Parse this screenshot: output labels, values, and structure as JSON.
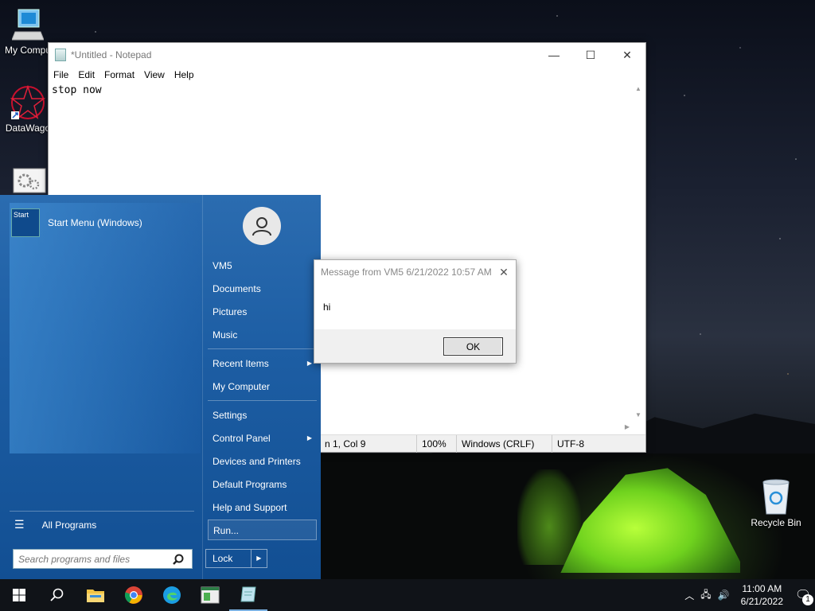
{
  "desktop": {
    "icons": [
      {
        "label": "My Compu",
        "icon": "computer-icon"
      },
      {
        "label": "DataWago",
        "icon": "datawagon-icon"
      },
      {
        "label": "",
        "icon": "settings-window-icon"
      },
      {
        "label": "Recycle Bin",
        "icon": "recycle-bin-icon"
      }
    ]
  },
  "notepad": {
    "title": "*Untitled - Notepad",
    "menu": [
      "File",
      "Edit",
      "Format",
      "View",
      "Help"
    ],
    "content": "stop now",
    "status": {
      "position": "n 1, Col 9",
      "zoom": "100%",
      "line_ending": "Windows (CRLF)",
      "encoding": "UTF-8"
    },
    "buttons": {
      "minimize": "—",
      "maximize": "☐",
      "close": "✕"
    }
  },
  "start_menu": {
    "pinned": {
      "label": "Start Menu (Windows)",
      "icon_label": "Start"
    },
    "all_programs": "All Programs",
    "search_placeholder": "Search programs and files",
    "right_items": {
      "user": "VM5",
      "documents": "Documents",
      "pictures": "Pictures",
      "music": "Music",
      "recent": "Recent Items",
      "computer": "My Computer",
      "settings": "Settings",
      "control_panel": "Control Panel",
      "devices": "Devices and Printers",
      "default_programs": "Default Programs",
      "help": "Help and Support",
      "run": "Run..."
    },
    "lock": "Lock"
  },
  "message_box": {
    "title": "Message from VM5 6/21/2022 10:57 AM",
    "body": "hi",
    "ok": "OK"
  },
  "taskbar": {
    "time": "11:00 AM",
    "date": "6/21/2022",
    "notification_count": "1"
  },
  "colors": {
    "start_menu_blue": "#1d5ea4",
    "taskbar": "#101318"
  }
}
